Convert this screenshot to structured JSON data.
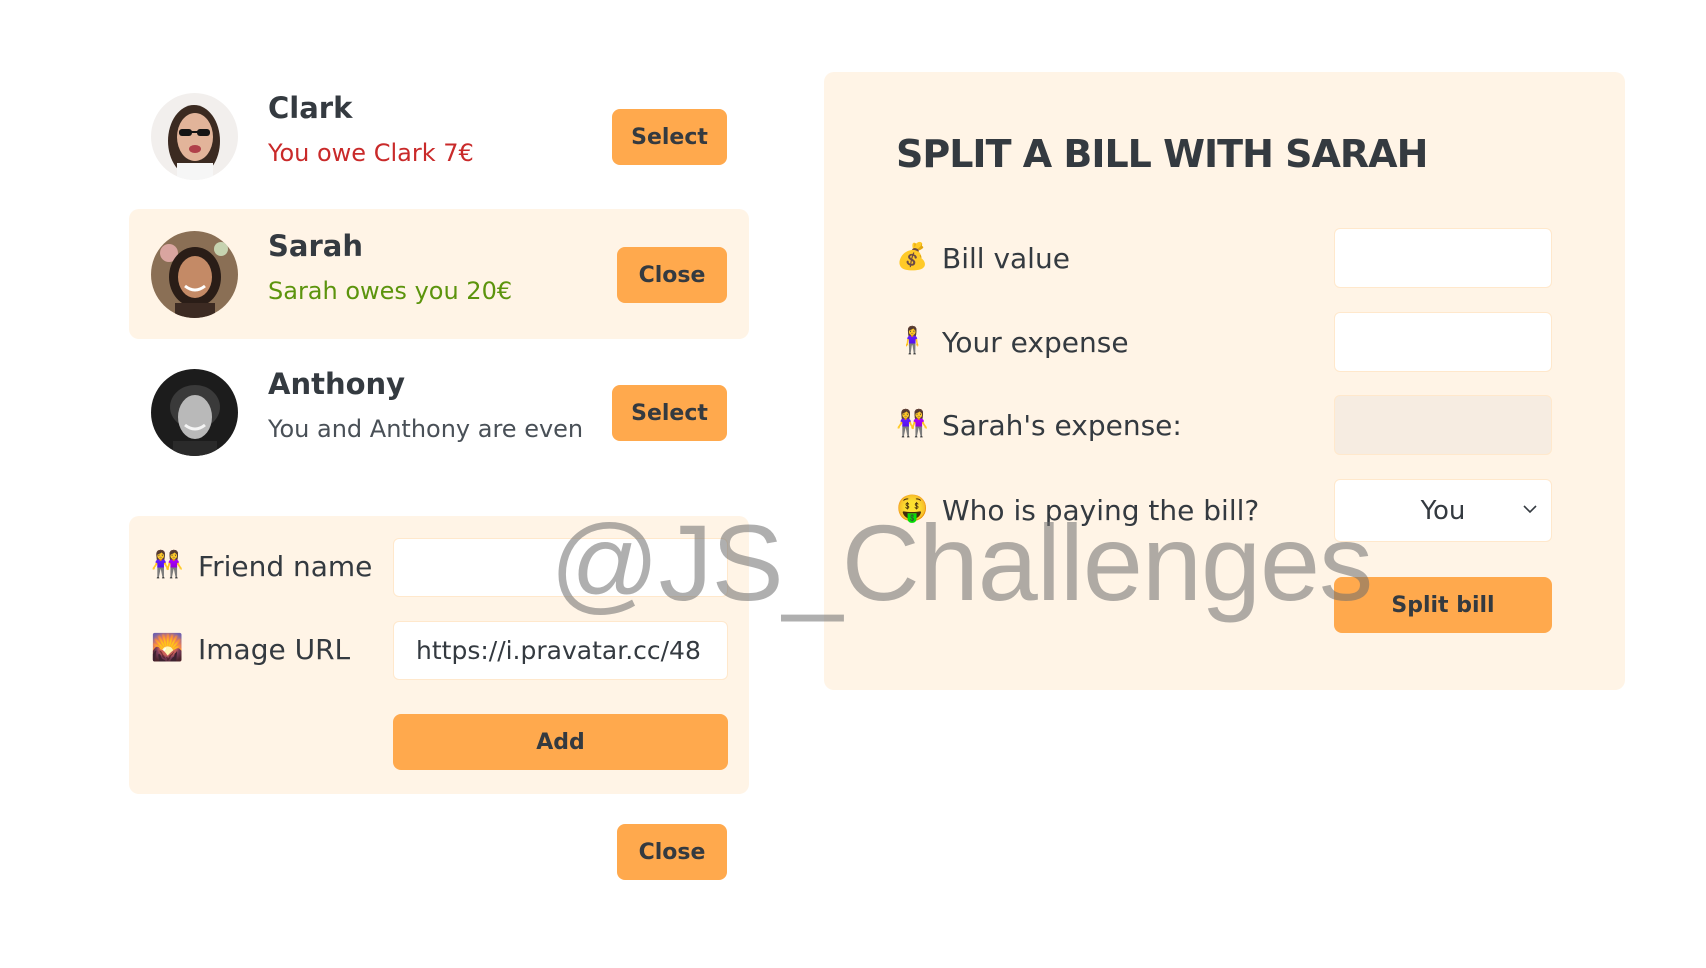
{
  "friends": [
    {
      "name": "Clark",
      "status": "You owe Clark 7€",
      "button_label": "Select",
      "avatar": "clark-avatar"
    },
    {
      "name": "Sarah",
      "status": "Sarah owes you 20€",
      "button_label": "Close",
      "avatar": "sarah-avatar"
    },
    {
      "name": "Anthony",
      "status": "You and Anthony are even",
      "button_label": "Select",
      "avatar": "anthony-avatar"
    }
  ],
  "add_friend": {
    "name_icon": "👭",
    "name_label": "Friend name",
    "name_value": "",
    "image_icon": "🌄",
    "image_label": "Image URL",
    "image_value": "https://i.pravatar.cc/48",
    "add_label": "Add"
  },
  "close_form_label": "Close",
  "split_bill": {
    "title": "SPLIT A BILL WITH SARAH",
    "bill_icon": "💰",
    "bill_label": "Bill value",
    "bill_value": "",
    "expense_icon": "🧍‍♀️",
    "expense_label": "Your expense",
    "expense_value": "",
    "friend_expense_icon": "👭",
    "friend_expense_label": "Sarah's expense:",
    "friend_expense_value": "",
    "payer_icon": "🤑",
    "payer_label": "Who is paying the bill?",
    "payer_value": "You",
    "submit_label": "Split bill"
  },
  "watermark": "@JS_Challenges",
  "colors": {
    "accent": "#ffa94d",
    "panel": "#fff4e6",
    "owe_red": "#c92a2a",
    "owed_green": "#5c940d",
    "heading": "#343a40"
  }
}
